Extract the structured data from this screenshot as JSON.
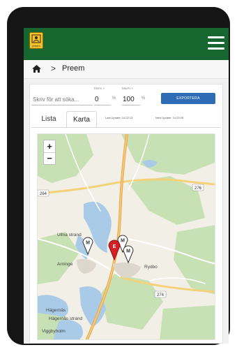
{
  "header": {
    "logo_text": "preem",
    "menu_icon": "hamburger-icon",
    "bg": "#17652f"
  },
  "breadcrumb": {
    "home_icon": "home-icon",
    "separator": ">",
    "current": "Preem"
  },
  "filters": {
    "search_placeholder": "Skriv för att söka...",
    "min_label": "Min% >",
    "min_value": "0",
    "max_label": "Max% <",
    "max_value": "100",
    "percent_sign": "%",
    "export_label": "EXPORTERA"
  },
  "tabs": {
    "list_label": "Lista",
    "map_label": "Karta",
    "active": "Karta"
  },
  "updates": {
    "last_update": "Last Update: 14:22:13",
    "next_update": "Next Update: 14:23:05"
  },
  "map": {
    "zoom_in": "+",
    "zoom_out": "−",
    "places": {
      "ullna": "Ullna strand",
      "arninge": "Arninge",
      "rydbo": "Rydbo",
      "hagernas": "Hägernäs",
      "hagernas_strand": "Hägernäs strand",
      "viggbyholm": "Viggbyholm"
    },
    "roads": {
      "r264": "264",
      "r276": "276",
      "r274": "274"
    },
    "markers": [
      {
        "label": "M",
        "color": "#ffffff"
      },
      {
        "label": "E",
        "color": "#d32027"
      },
      {
        "label": "M",
        "color": "#ffffff"
      },
      {
        "label": "M",
        "color": "#ffffff"
      }
    ],
    "colors": {
      "water": "#a9cbe8",
      "forest": "#c7e0b4",
      "land": "#f2efe6",
      "highway": "#e8a94a",
      "marker_red": "#d32027"
    }
  }
}
